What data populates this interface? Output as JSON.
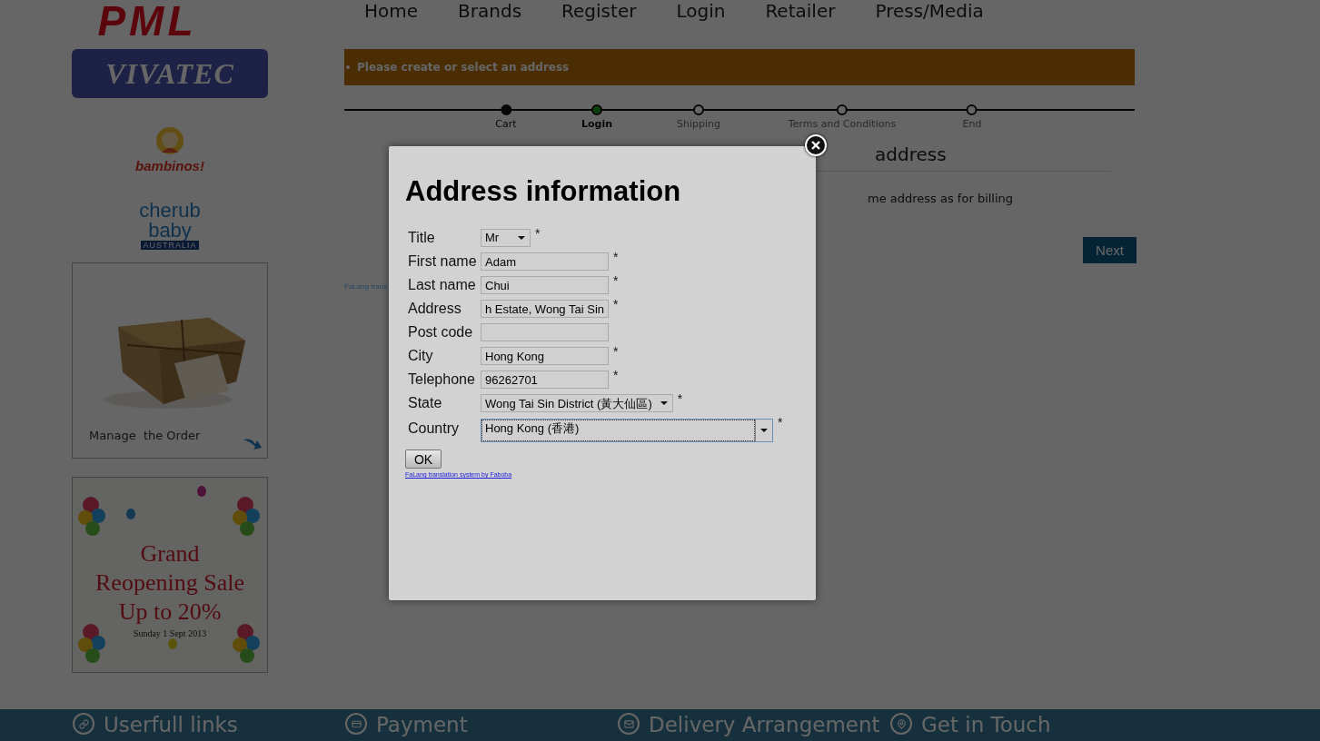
{
  "sidebar": {
    "logos": [
      {
        "kind": "pml",
        "text": "PML"
      },
      {
        "kind": "vivatec",
        "text": "VIVATEC"
      },
      {
        "kind": "bambinos",
        "text": "bambinos!"
      },
      {
        "kind": "cherub",
        "text": "cherub baby",
        "subtext": "AUSTRALIA"
      }
    ],
    "cards": [
      {
        "kind": "order",
        "caption": "Manage  the Order"
      },
      {
        "kind": "sale",
        "lines": [
          "Grand",
          "Reopening Sale",
          "Up to 20%"
        ],
        "date": "Sunday 1 Sept 2013"
      }
    ]
  },
  "nav": [
    "Home",
    "Brands",
    "Register",
    "Login",
    "Retailer",
    "Press/Media"
  ],
  "alert": "Please create or select an address",
  "steps": [
    {
      "label": "Cart",
      "done": true,
      "selected": false
    },
    {
      "label": "Login",
      "done": false,
      "selected": true
    },
    {
      "label": "Shipping",
      "done": false,
      "selected": false
    },
    {
      "label": "Terms and Conditions",
      "done": false,
      "selected": false
    },
    {
      "label": "End",
      "done": false,
      "selected": false
    }
  ],
  "shipping_section": {
    "heading": "address",
    "option": "me address as for billing",
    "next_button": "Next"
  },
  "credit_fragment": "FaLang trans",
  "dialog": {
    "title": "Address information",
    "fields": [
      {
        "label": "Title",
        "kind": "select",
        "value": "Mr",
        "required_mark": "*",
        "focused": false
      },
      {
        "label": "First name",
        "kind": "text",
        "value": "Adam",
        "required_mark": "*",
        "focused": false
      },
      {
        "label": "Last name",
        "kind": "text",
        "value": "Chui",
        "required_mark": "*",
        "focused": false
      },
      {
        "label": "Address",
        "kind": "text",
        "value": "h Estate, Wong Tai Sin",
        "required_mark": "*",
        "focused": false
      },
      {
        "label": "Post code",
        "kind": "text",
        "focused": false
      },
      {
        "label": "City",
        "kind": "text",
        "value": "Hong Kong",
        "required_mark": "*",
        "focused": false
      },
      {
        "label": "Telephone",
        "kind": "text",
        "value": "96262701",
        "required_mark": "*",
        "focused": false
      },
      {
        "label": "State",
        "kind": "select",
        "value": "Wong Tai Sin District (黃大仙區)",
        "required_mark": "*",
        "focused": false
      },
      {
        "label": "Country",
        "kind": "select",
        "value": "Hong Kong (香港)",
        "required_mark": "*",
        "focused": true
      }
    ],
    "ok_button": "OK",
    "credit_link": "FaLang translation system by Faboba"
  },
  "footer": [
    {
      "label": "Userfull links"
    },
    {
      "label": "Payment"
    },
    {
      "label": "Delivery Arrangement"
    },
    {
      "label": "Get in Touch"
    }
  ]
}
